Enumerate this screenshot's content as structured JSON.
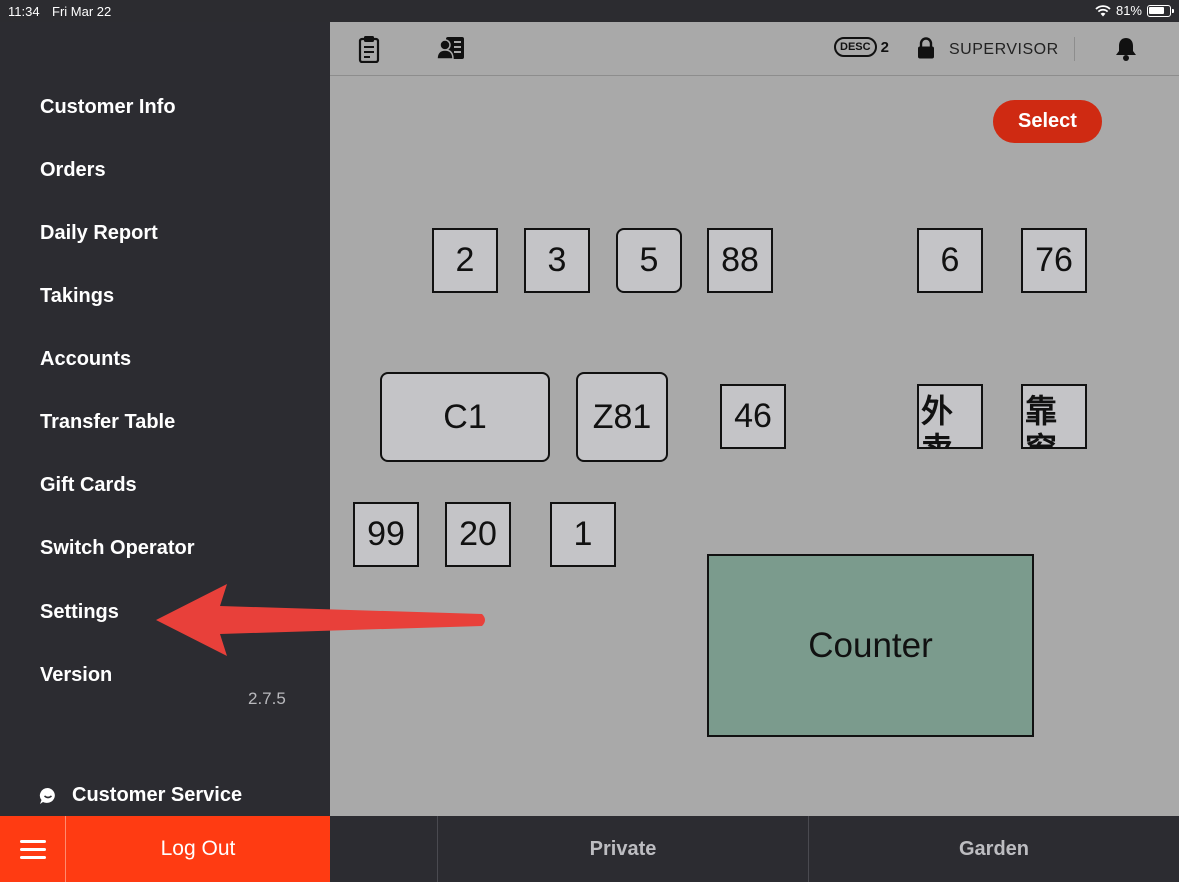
{
  "status_bar": {
    "time": "11:34",
    "date": "Fri Mar 22",
    "battery": "81%",
    "battery_level": 0.81
  },
  "sidebar": {
    "items": [
      {
        "label": "Customer Info"
      },
      {
        "label": "Orders"
      },
      {
        "label": "Daily Report"
      },
      {
        "label": "Takings"
      },
      {
        "label": "Accounts"
      },
      {
        "label": "Transfer Table"
      },
      {
        "label": "Gift Cards"
      },
      {
        "label": "Switch Operator"
      },
      {
        "label": "Settings"
      },
      {
        "label": "Version"
      }
    ],
    "version_value": "2.7.5",
    "customer_service": "Customer Service"
  },
  "bottom": {
    "logout": "Log Out",
    "zones": [
      "Private",
      "Garden"
    ]
  },
  "toolbar": {
    "desc_label": "DESC",
    "desc_count": "2",
    "role": "SUPERVISOR"
  },
  "floor": {
    "select_label": "Select",
    "tables": [
      "2",
      "3",
      "5",
      "88",
      "6",
      "76",
      "C1",
      "Z81",
      "46",
      "外卖",
      "靠窗",
      "99",
      "20",
      "1"
    ],
    "counter": "Counter"
  },
  "colors": {
    "accent": "#ff3b12",
    "select": "#cf2a12",
    "counter": "#7b9b8d",
    "arrow": "#e8403a"
  }
}
